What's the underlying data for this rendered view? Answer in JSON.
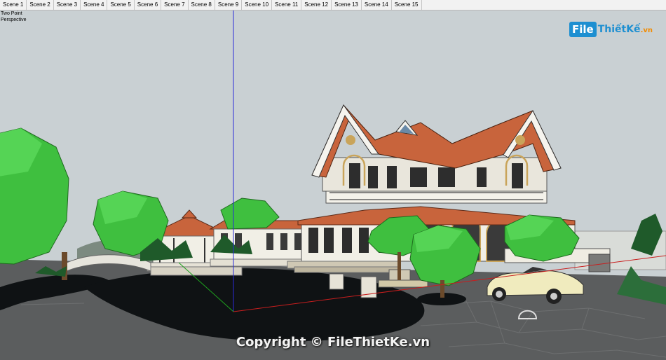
{
  "scene_tabs": [
    "Scene 1",
    "Scene 2",
    "Scene 3",
    "Scene 4",
    "Scene 5",
    "Scene 6",
    "Scene 7",
    "Scene 8",
    "Scene 9",
    "Scene 10",
    "Scene 11",
    "Scene 12",
    "Scene 13",
    "Scene 14",
    "Scene 15"
  ],
  "view": {
    "line1": "Two Point",
    "line2": "Perspective"
  },
  "logo": {
    "file": "File",
    "rest": "ThiếtKế",
    "domain": ".vn"
  },
  "copyright": "Copyright © FileThietKe.vn",
  "colors": {
    "sky": "#c9d0d3",
    "roof": "#c8643c",
    "wall": "#f1efe6",
    "tree": "#3fbf3f",
    "paving": "#5b5d5e",
    "asphalt": "#0f1214",
    "axis_blue": "#2b2bd8",
    "axis_red": "#c81e1e",
    "axis_green": "#1ea01e"
  }
}
